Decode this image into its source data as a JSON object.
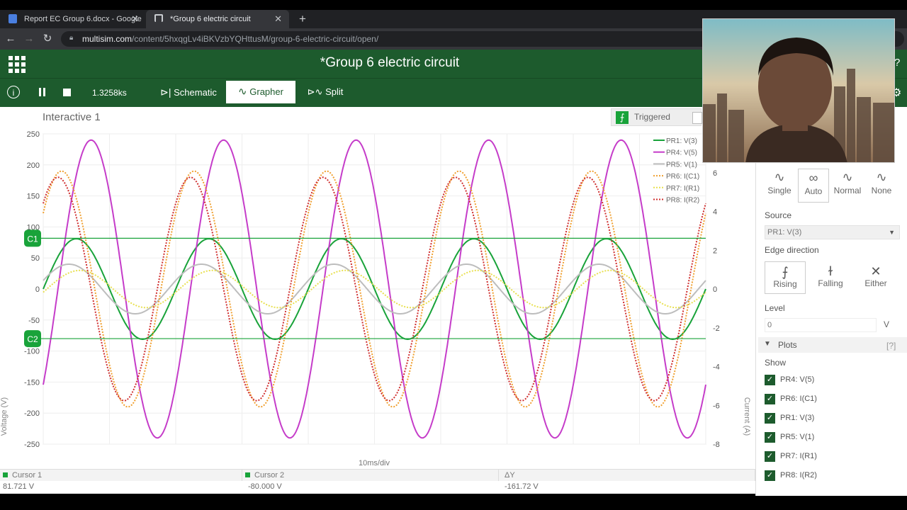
{
  "browser": {
    "tabs": [
      {
        "title": "Report EC Group 6.docx - Google",
        "icon_color": "#4a7fe0"
      },
      {
        "title": "*Group 6 electric circuit",
        "icon_color": "#c9ccd0"
      }
    ],
    "new_tab": "+",
    "url_domain": "multisim.com",
    "url_path": "/content/5hxqgLv4iBKVzbYQHttusM/group-6-electric-circuit/open/"
  },
  "app": {
    "title": "*Group 6 electric circuit",
    "help": "?",
    "time": "1.3258ks",
    "tabs": {
      "schematic": "Schematic",
      "grapher": "Grapher",
      "split": "Split"
    },
    "accent": "#1d5b2d"
  },
  "grapher": {
    "panel_title": "Interactive 1",
    "triggered_label": "Triggered",
    "x_label": "10ms/div",
    "y_label_left": "Voltage (V)",
    "y_label_right": "Current (A)",
    "cursors": {
      "c1_label": "C1",
      "c2_label": "C2",
      "cursor1_header": "Cursor 1",
      "cursor1_value": "81.721 V",
      "cursor2_header": "Cursor 2",
      "cursor2_value": "-80.000 V",
      "delta_header": "ΔY",
      "delta_value": "-161.72 V"
    }
  },
  "chart_data": {
    "type": "line",
    "x_range": [
      0,
      50
    ],
    "x_unit_label": "10ms/div",
    "y_left": {
      "label": "Voltage (V)",
      "range": [
        -250,
        250
      ],
      "ticks": [
        250,
        200,
        150,
        100,
        50,
        0,
        -50,
        -100,
        -150,
        -200,
        -250
      ]
    },
    "y_right": {
      "label": "Current (A)",
      "range": [
        -8,
        8
      ],
      "ticks": [
        6,
        4,
        2,
        0,
        -2,
        -4,
        -6,
        -8
      ]
    },
    "grid": true,
    "legend_position": "top-right",
    "cursors": [
      81.721,
      -80.0
    ],
    "period_ms": 10,
    "series": [
      {
        "name": "PR1: V(3)",
        "color": "#19a33a",
        "style": "solid",
        "axis": "left",
        "amplitude": 81,
        "phase_deg": 0
      },
      {
        "name": "PR4: V(5)",
        "color": "#c53cc9",
        "style": "solid",
        "axis": "left",
        "amplitude": 240,
        "phase_deg": -40
      },
      {
        "name": "PR5: V(1)",
        "color": "#bdbdbd",
        "style": "solid",
        "axis": "left",
        "amplitude": 40,
        "phase_deg": 20
      },
      {
        "name": "PR6: I(C1)",
        "color": "#f0a030",
        "style": "dotted",
        "axis": "left",
        "amplitude": 190,
        "phase_deg": 40
      },
      {
        "name": "PR7: I(R1)",
        "color": "#e8e050",
        "style": "dotted",
        "axis": "left",
        "amplitude": 30,
        "phase_deg": -10
      },
      {
        "name": "PR8: I(R2)",
        "color": "#d03030",
        "style": "dotted",
        "axis": "left",
        "amplitude": 180,
        "phase_deg": 50
      }
    ]
  },
  "trigger_panel": {
    "modes": [
      "Single",
      "Auto",
      "Normal",
      "None"
    ],
    "selected_mode": "Auto",
    "source_label": "Source",
    "source_value": "PR1: V(3)",
    "edge_label": "Edge direction",
    "edges": [
      "Rising",
      "Falling",
      "Either"
    ],
    "selected_edge": "Rising",
    "level_label": "Level",
    "level_value": "0",
    "level_unit": "V",
    "plots_label": "Plots",
    "plots_help": "[?]",
    "show_label": "Show",
    "plot_items": [
      "PR4: V(5)",
      "PR6: I(C1)",
      "PR1: V(3)",
      "PR5: V(1)",
      "PR7: I(R1)",
      "PR8: I(R2)"
    ]
  }
}
